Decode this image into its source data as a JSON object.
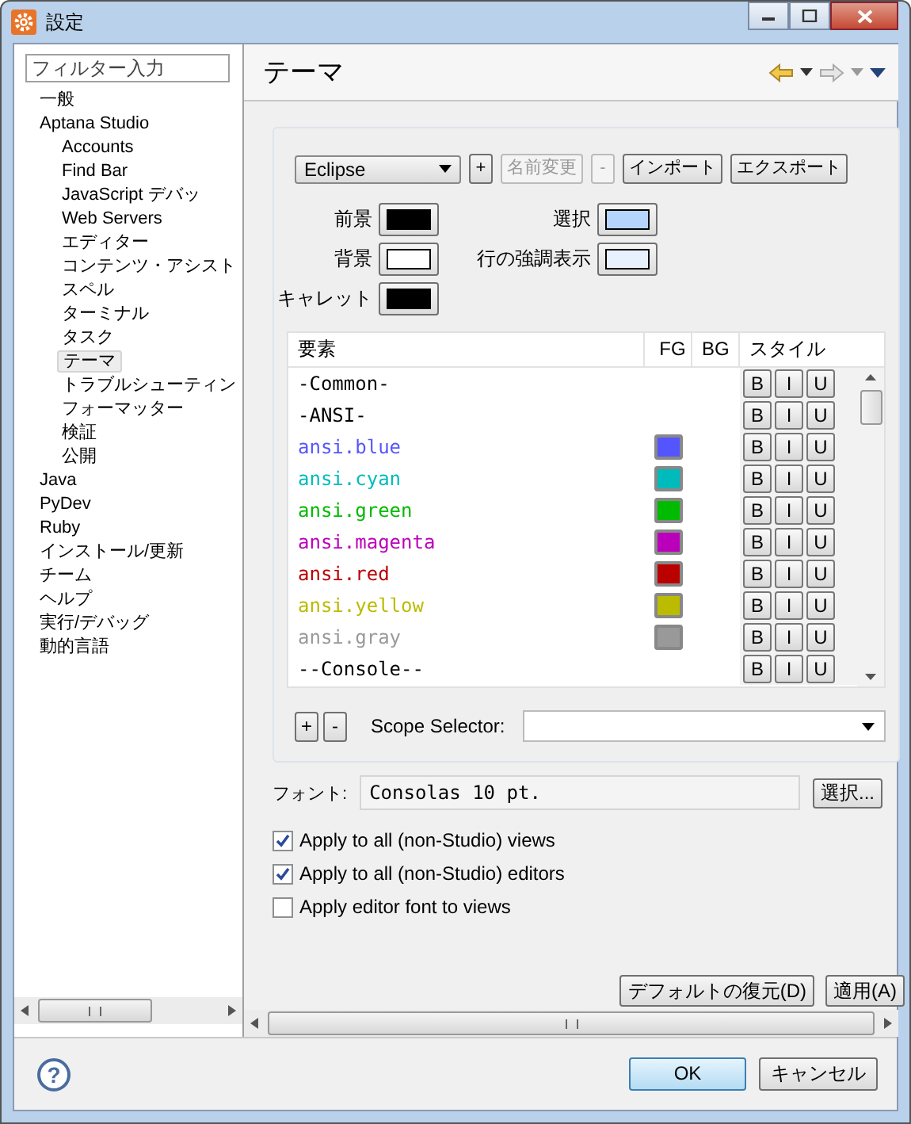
{
  "window": {
    "title": "設定"
  },
  "sidebar": {
    "filter": {
      "placeholder": "フィルター入力"
    },
    "tree": [
      {
        "label": "一般",
        "selected": false
      },
      {
        "label": "Aptana Studio",
        "selected": false,
        "children": [
          {
            "label": "Accounts",
            "selected": false
          },
          {
            "label": "Find Bar",
            "selected": false
          },
          {
            "label": "JavaScript デバッ",
            "selected": false
          },
          {
            "label": "Web Servers",
            "selected": false
          },
          {
            "label": "エディター",
            "selected": false
          },
          {
            "label": "コンテンツ・アシスト",
            "selected": false
          },
          {
            "label": "スペル",
            "selected": false
          },
          {
            "label": "ターミナル",
            "selected": false
          },
          {
            "label": "タスク",
            "selected": false
          },
          {
            "label": "テーマ",
            "selected": true
          },
          {
            "label": "トラブルシューティン",
            "selected": false
          },
          {
            "label": "フォーマッター",
            "selected": false
          },
          {
            "label": "検証",
            "selected": false
          },
          {
            "label": "公開",
            "selected": false
          }
        ]
      },
      {
        "label": "Java",
        "selected": false
      },
      {
        "label": "PyDev",
        "selected": false
      },
      {
        "label": "Ruby",
        "selected": false
      },
      {
        "label": "インストール/更新",
        "selected": false
      },
      {
        "label": "チーム",
        "selected": false
      },
      {
        "label": "ヘルプ",
        "selected": false
      },
      {
        "label": "実行/デバッグ",
        "selected": false
      },
      {
        "label": "動的言語",
        "selected": false
      }
    ]
  },
  "page": {
    "title": "テーマ",
    "theme": {
      "value": "Eclipse",
      "add": "+",
      "rename": "名前変更",
      "rename_disabled": true,
      "remove": "-",
      "remove_disabled": true,
      "import": "インポート",
      "export": "エクスポート"
    },
    "colors": [
      {
        "label": "前景",
        "color": "#000000"
      },
      {
        "label": "選択",
        "color": "#b5d5ff"
      },
      {
        "label": "背景",
        "color": "#ffffff"
      },
      {
        "label": "行の強調表示",
        "color": "#e8f2fe"
      },
      {
        "label": "キャレット",
        "color": "#000000"
      }
    ],
    "table": {
      "columns": [
        "要素",
        "FG",
        "BG",
        "スタイル"
      ],
      "rows": [
        {
          "name": "-Common-",
          "color": "#000000",
          "style": [
            "B",
            "I",
            "U"
          ]
        },
        {
          "name": "-ANSI-",
          "color": "#000000",
          "style": [
            "B",
            "I",
            "U"
          ]
        },
        {
          "name": "ansi.blue",
          "color": "#5555ff",
          "fg": {
            "color": "#5555ff"
          },
          "style": [
            "B",
            "I",
            "U"
          ]
        },
        {
          "name": "ansi.cyan",
          "color": "#00bbbb",
          "fg": {
            "color": "#00bbbb"
          },
          "style": [
            "B",
            "I",
            "U"
          ]
        },
        {
          "name": "ansi.green",
          "color": "#00bb00",
          "fg": {
            "color": "#00bb00"
          },
          "style": [
            "B",
            "I",
            "U"
          ]
        },
        {
          "name": "ansi.magenta",
          "color": "#bb00bb",
          "fg": {
            "color": "#bb00bb"
          },
          "style": [
            "B",
            "I",
            "U"
          ]
        },
        {
          "name": "ansi.red",
          "color": "#bb0000",
          "fg": {
            "color": "#bb0000"
          },
          "style": [
            "B",
            "I",
            "U"
          ]
        },
        {
          "name": "ansi.yellow",
          "color": "#bbbb00",
          "fg": {
            "color": "#bbbb00"
          },
          "style": [
            "B",
            "I",
            "U"
          ]
        },
        {
          "name": "ansi.gray",
          "color": "#999999",
          "fg": {
            "color": "#999999"
          },
          "style": [
            "B",
            "I",
            "U"
          ]
        },
        {
          "name": "--Console--",
          "color": "#000000",
          "style": [
            "B",
            "I",
            "U"
          ]
        }
      ]
    },
    "scope": {
      "add": "+",
      "remove": "-",
      "label": "Scope Selector:"
    },
    "font": {
      "label": "フォント:",
      "value": "Consolas 10 pt.",
      "button": "選択..."
    },
    "options": [
      {
        "label": "Apply to all (non-Studio) views",
        "checked": true
      },
      {
        "label": "Apply to all (non-Studio) editors",
        "checked": true
      },
      {
        "label": "Apply editor font to views",
        "checked": false
      }
    ],
    "buttons": [
      "デフォルトの復元(D)",
      "適用(A)"
    ]
  },
  "footer": {
    "help": "?",
    "buttons": [
      {
        "label": "OK",
        "default": true
      },
      {
        "label": "キャンセル",
        "default": false
      }
    ]
  }
}
